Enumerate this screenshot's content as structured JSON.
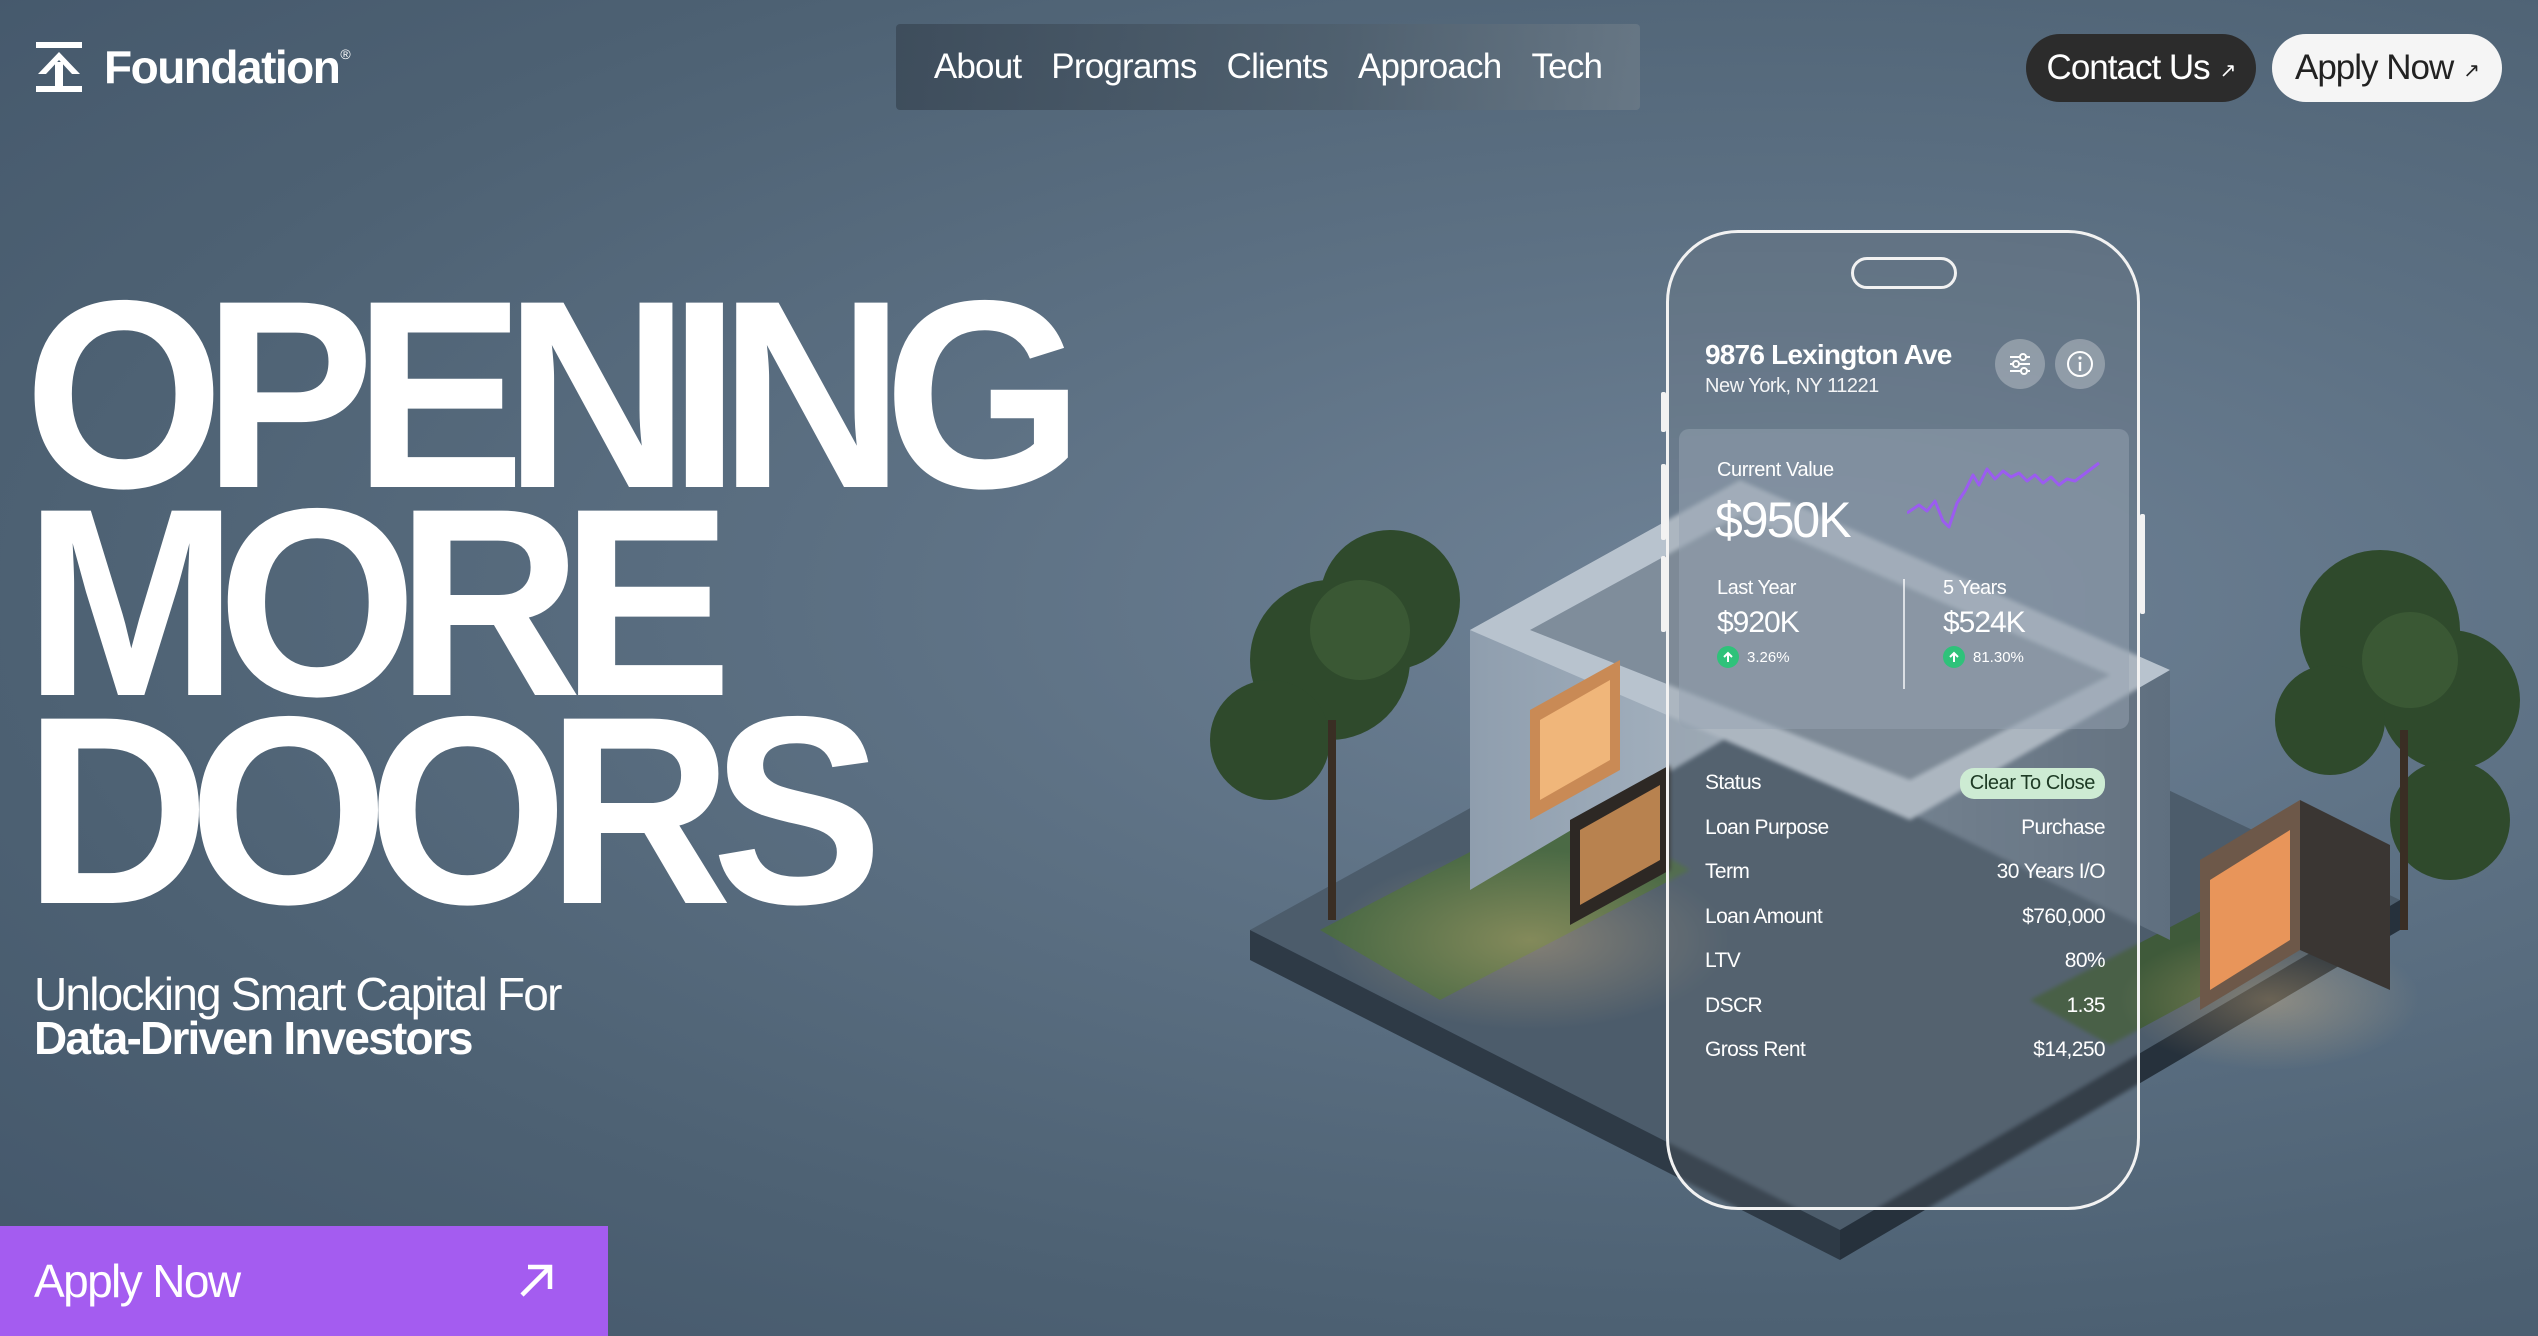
{
  "header": {
    "logo_text": "Foundation",
    "logo_mark": "®",
    "nav": [
      "About",
      "Programs",
      "Clients",
      "Approach",
      "Tech"
    ],
    "contact_label": "Contact Us",
    "apply_label": "Apply Now",
    "arrow_glyph": "↗"
  },
  "hero": {
    "line1": "OPENING",
    "line2": "MORE",
    "line3": "DOORS",
    "sub_line1": "Unlocking Smart Capital For",
    "sub_line2": "Data-Driven Investors",
    "cta_label": "Apply Now"
  },
  "property": {
    "street": "9876 Lexington Ave",
    "city": "New York, NY 11221",
    "current_value_label": "Current Value",
    "current_value": "$950K",
    "last_year_label": "Last Year",
    "last_year_value": "$920K",
    "last_year_change": "3.26%",
    "five_years_label": "5 Years",
    "five_years_value": "$524K",
    "five_years_change": "81.30%",
    "status_label": "Status",
    "status_value": "Clear To Close",
    "details": [
      {
        "label": "Loan Purpose",
        "value": "Purchase"
      },
      {
        "label": "Term",
        "value": "30 Years I/O"
      },
      {
        "label": "Loan Amount",
        "value": "$760,000"
      },
      {
        "label": "LTV",
        "value": "80%"
      },
      {
        "label": "DSCR",
        "value": "1.35"
      },
      {
        "label": "Gross Rent",
        "value": "$14,250"
      }
    ]
  },
  "colors": {
    "accent": "#a45cf0",
    "sparkline": "#9b5cf0",
    "status_badge": "#cdebd3",
    "up_indicator": "#2fc27a"
  },
  "icons": [
    "logo-mark-icon",
    "arrow-up-right-icon",
    "sliders-icon",
    "info-icon",
    "arrow-up-icon"
  ]
}
